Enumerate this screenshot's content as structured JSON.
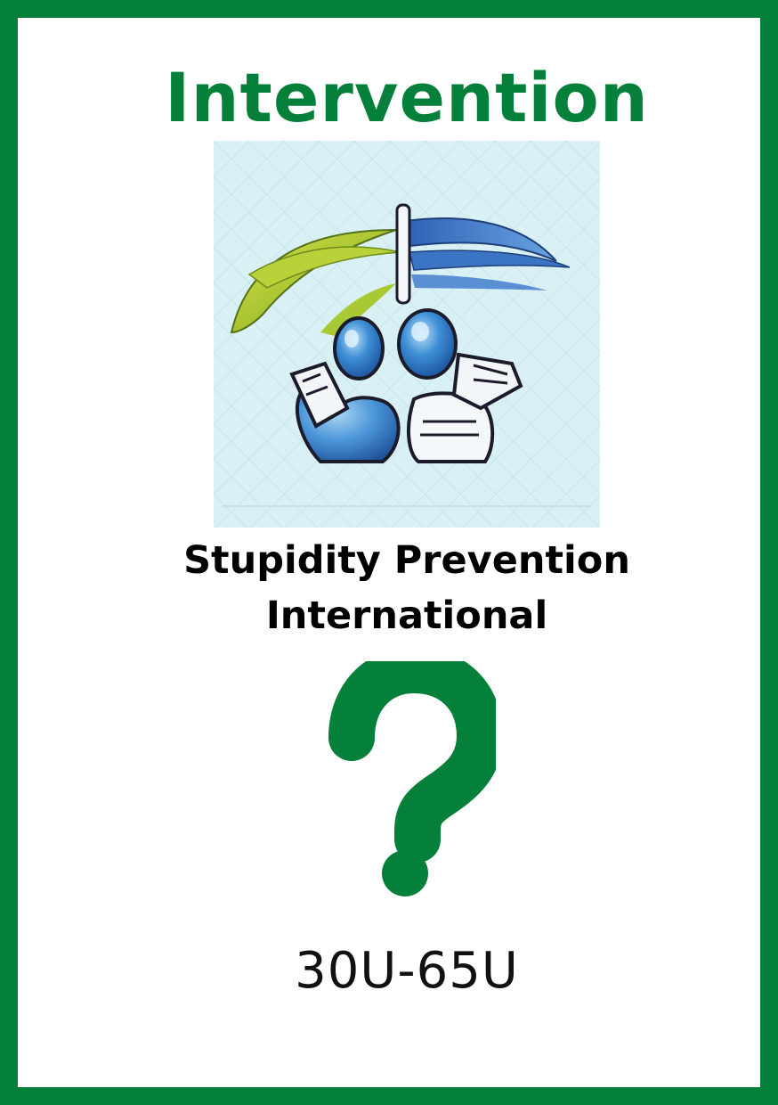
{
  "card": {
    "title": "Intervention",
    "organization_line1": "Stupidity Prevention",
    "organization_line2": "International",
    "range": "30U-65U"
  },
  "colors": {
    "border": "#05803a",
    "title": "#05803a",
    "question_mark": "#05803a",
    "text": "#000000",
    "illustration_background": "#d9f1f5"
  },
  "icons": {
    "illustration": "two-figures-under-leaves-illustration",
    "question": "question-mark-icon"
  }
}
